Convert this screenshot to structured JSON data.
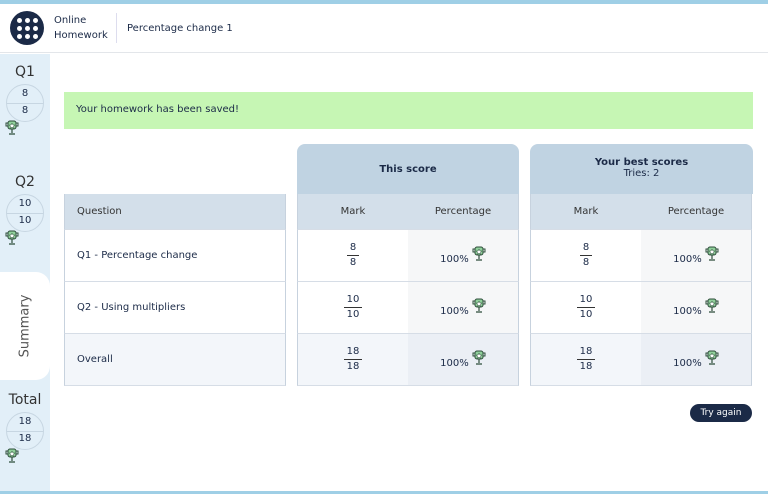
{
  "header": {
    "brand": "Online Homework",
    "title": "Percentage change 1"
  },
  "sidebar": {
    "q1": {
      "label": "Q1",
      "num": "8",
      "den": "8"
    },
    "q2": {
      "label": "Q2",
      "num": "10",
      "den": "10"
    },
    "summary": "Summary",
    "total": {
      "label": "Total",
      "num": "18",
      "den": "18"
    }
  },
  "banner": "Your homework has been saved!",
  "this_score": {
    "title": "This score"
  },
  "best_scores": {
    "title": "Your best scores",
    "tries": "Tries: 2"
  },
  "columns": {
    "question": "Question",
    "mark": "Mark",
    "percentage": "Percentage"
  },
  "rows": [
    {
      "q": "Q1 - Percentage change",
      "num": "8",
      "den": "8",
      "pct": "100%",
      "bnum": "8",
      "bden": "8",
      "bpct": "100%"
    },
    {
      "q": "Q2 - Using multipliers",
      "num": "10",
      "den": "10",
      "pct": "100%",
      "bnum": "10",
      "bden": "10",
      "bpct": "100%"
    },
    {
      "q": "Overall",
      "num": "18",
      "den": "18",
      "pct": "100%",
      "bnum": "18",
      "bden": "18",
      "bpct": "100%"
    }
  ],
  "try_again": "Try again",
  "colors": {
    "accent": "#1b2a47",
    "banner": "#c6f6b4",
    "trophy": "#5b9a6c"
  }
}
